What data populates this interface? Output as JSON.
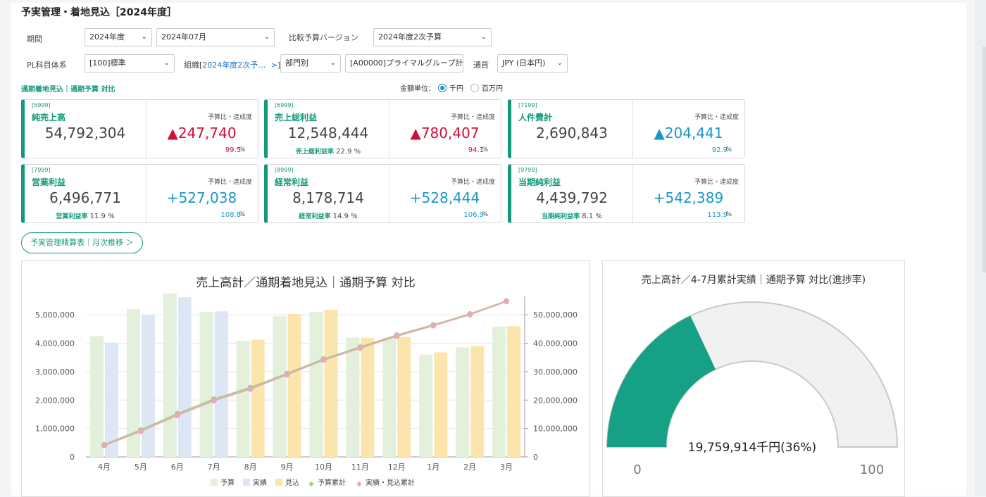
{
  "page_title": "予実管理・着地見込［2024年度］",
  "filters": {
    "period_label": "期間",
    "fiscal_year": "2024年度",
    "month": "2024年07月",
    "compare_label": "比較予算バージョン",
    "compare_version": "2024年度2次予算",
    "pl_label": "PL科目体系",
    "pl_value": "[100]標準",
    "org_label": "組織",
    "org_prefix": "[",
    "org_value": "2024年度2次予…",
    "org_suffix": "]",
    "dept_mode": "部門別",
    "dept_value": "[A00000]プライマルグループ計",
    "currency_label": "通貨",
    "currency_value": "JPY (日本円)"
  },
  "section_label": "通期着地見込｜通期予算 対比",
  "unit": {
    "label": "金額単位：",
    "options": [
      "千円",
      "百万円"
    ],
    "selected": "千円"
  },
  "kpi_cards": [
    {
      "code": "[5999]",
      "name": "純売上高",
      "value": "54,792,304",
      "compare_label": "予算比・達成度",
      "diff": "▲247,740",
      "pct": "99.5",
      "pct_unit": "%",
      "tone": "red",
      "rate_label": "",
      "rate_value": ""
    },
    {
      "code": "[6999]",
      "name": "売上総利益",
      "value": "12,548,444",
      "compare_label": "予算比・達成度",
      "diff": "▲780,407",
      "pct": "94.1",
      "pct_unit": "%",
      "tone": "red",
      "rate_label": "売上総利益率",
      "rate_value": "22.9 %"
    },
    {
      "code": "[7199]",
      "name": "人件費計",
      "value": "2,690,843",
      "compare_label": "予算比・達成度",
      "diff": "▲204,441",
      "pct": "92.9",
      "pct_unit": "%",
      "tone": "blue",
      "rate_label": "",
      "rate_value": ""
    },
    {
      "code": "[7999]",
      "name": "営業利益",
      "value": "6,496,771",
      "compare_label": "予算比・達成度",
      "diff": "+527,038",
      "pct": "108.8",
      "pct_unit": "%",
      "tone": "blue",
      "rate_label": "営業利益率",
      "rate_value": "11.9 %"
    },
    {
      "code": "[8999]",
      "name": "経常利益",
      "value": "8,178,714",
      "compare_label": "予算比・達成度",
      "diff": "+528,444",
      "pct": "106.9",
      "pct_unit": "%",
      "tone": "blue",
      "rate_label": "経常利益率",
      "rate_value": "14.9 %"
    },
    {
      "code": "[9799]",
      "name": "当期純利益",
      "value": "4,439,792",
      "compare_label": "予算比・達成度",
      "diff": "+542,389",
      "pct": "113.9",
      "pct_unit": "%",
      "tone": "blue",
      "rate_label": "当期純利益率",
      "rate_value": "8.1 %"
    }
  ],
  "report_button": "予実管理精算表｜月次推移 ＞",
  "chart_data": [
    {
      "type": "bar",
      "title": "売上高計／通期着地見込｜通期予算 対比",
      "categories": [
        "4月",
        "5月",
        "6月",
        "7月",
        "8月",
        "9月",
        "10月",
        "11月",
        "12月",
        "1月",
        "2月",
        "3月"
      ],
      "ylim": [
        0,
        5500000
      ],
      "y2lim": [
        0,
        55000000
      ],
      "yticks": [
        "0",
        "1,000,000",
        "2,000,000",
        "3,000,000",
        "4,000,000",
        "5,000,000"
      ],
      "y2ticks": [
        "0",
        "10,000,000",
        "20,000,000",
        "30,000,000",
        "40,000,000",
        "50,000,000"
      ],
      "series": [
        {
          "name": "予算",
          "kind": "bar",
          "color": "#e3f0dc",
          "values": [
            4250000,
            5200000,
            5750000,
            5100000,
            4080000,
            4950000,
            5100000,
            4200000,
            4200000,
            3600000,
            3850000,
            4580000
          ]
        },
        {
          "name": "実績",
          "kind": "bar",
          "color": "#dde6f5",
          "values": [
            4020000,
            4980000,
            5620000,
            5120000,
            null,
            null,
            null,
            null,
            null,
            null,
            null,
            null
          ]
        },
        {
          "name": "見込",
          "kind": "bar",
          "color": "#fce5ad",
          "values": [
            null,
            null,
            null,
            null,
            4130000,
            5030000,
            5180000,
            4190000,
            4220000,
            3680000,
            3900000,
            4600000
          ]
        },
        {
          "name": "予算累計",
          "kind": "line",
          "axis": "right",
          "color": "#9fd08a",
          "values": [
            4250000,
            9450000,
            15200000,
            20300000,
            24380000,
            29330000,
            34430000,
            38630000,
            42830000,
            46430000,
            50280000,
            54860000
          ]
        },
        {
          "name": "実績・見込累計",
          "kind": "line",
          "axis": "right",
          "color": "#e8aab9",
          "values": [
            4020000,
            9000000,
            14620000,
            19740000,
            23870000,
            28900000,
            34080000,
            38270000,
            42490000,
            46170000,
            50070000,
            54670000
          ]
        }
      ],
      "legend": "bottom"
    },
    {
      "type": "gauge",
      "title": "売上高計／4-7月累計実績｜通期予算 対比(進捗率)",
      "value": 36,
      "min": 0,
      "max": 100,
      "min_label": "0",
      "max_label": "100",
      "center_label": "19,759,914千円(36%)",
      "fill_color": "#16a085",
      "track_color": "#f1f1f1"
    }
  ]
}
